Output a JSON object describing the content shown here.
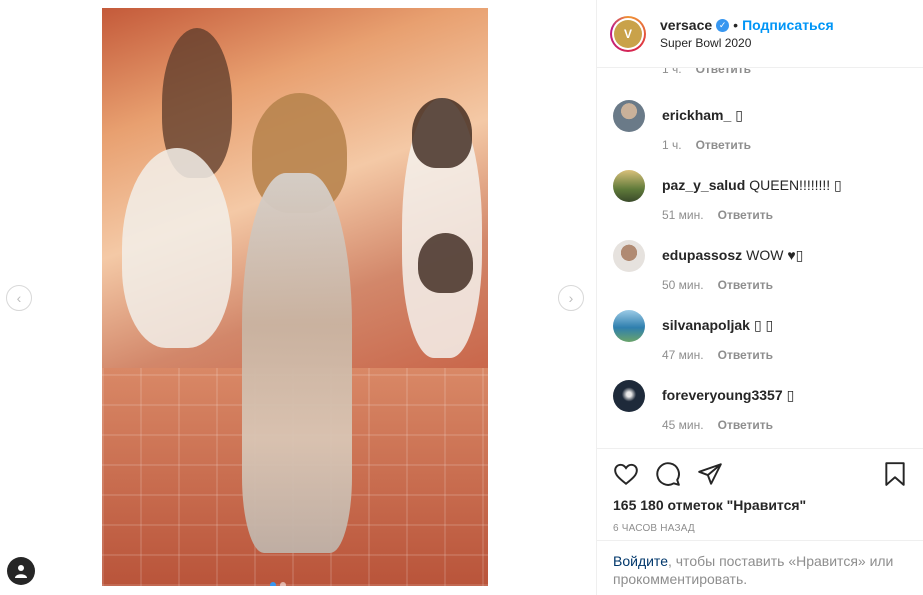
{
  "post": {
    "username": "versace",
    "verified_icon": "verified-badge-icon",
    "bullet": "•",
    "follow_label": "Подписаться",
    "location": "Super Bowl 2020",
    "avatar_text": "V"
  },
  "comments": {
    "partial": {
      "time": "1 ч.",
      "reply": "Ответить"
    },
    "items": [
      {
        "username": "erickham_",
        "text": "▯",
        "time": "1 ч.",
        "reply": "Ответить",
        "avatar_color": "#6a7a88"
      },
      {
        "username": "paz_y_salud",
        "text": "QUEEN!!!!!!!! ▯",
        "time": "51 мин.",
        "reply": "Ответить",
        "avatar_color": "#5f7a3a"
      },
      {
        "username": "edupassosz",
        "text": "WOW ♥▯",
        "time": "50 мин.",
        "reply": "Ответить",
        "avatar_color": "#8a6a5a"
      },
      {
        "username": "silvanapoljak",
        "text": "▯ ▯",
        "time": "47 мин.",
        "reply": "Ответить",
        "avatar_color": "#2f7fae"
      },
      {
        "username": "foreveryoung3357",
        "text": "▯",
        "time": "45 мин.",
        "reply": "Ответить",
        "avatar_color": "#1e2a3a"
      }
    ]
  },
  "actions": {
    "like_icon": "heart-icon",
    "comment_icon": "comment-icon",
    "share_icon": "share-icon",
    "save_icon": "bookmark-icon"
  },
  "likes_text": "165 180 отметок \"Нравится\"",
  "timestamp": "6 часов назад",
  "login_prompt": {
    "link": "Войдите",
    "text": ", чтобы поставить «Нравится» или прокомментировать."
  },
  "carousel": {
    "prev": "‹",
    "next": "›",
    "slides": 2,
    "active_slide": 1
  },
  "colors": {
    "accent": "#0095f6",
    "muted": "#8e8e8e",
    "text": "#262626",
    "border": "#efefef"
  }
}
